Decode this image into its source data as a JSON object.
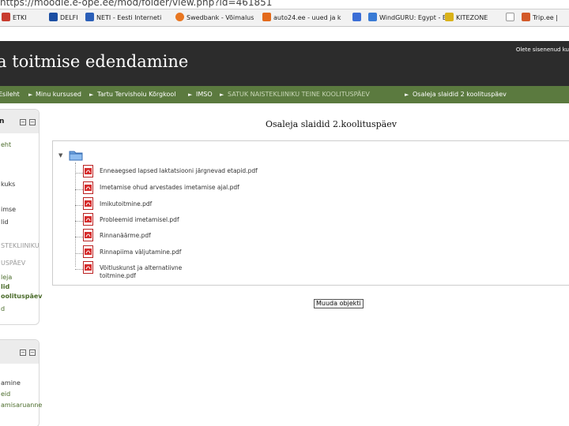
{
  "browser": {
    "url": "https://moodle.e-ope.ee/mod/folder/view.php?id=461851",
    "bookmarks": [
      {
        "label": "ETKI",
        "color": "#c83b2e"
      },
      {
        "label": "DELFI",
        "color": "#1c4fa3"
      },
      {
        "label": "NETI - Eesti Interneti",
        "color": "#2b5fb8"
      },
      {
        "label": "Swedbank - Võimalus",
        "color": "#e87722"
      },
      {
        "label": "auto24.ee - uued ja k",
        "color": "#e36a1b"
      },
      {
        "label": "",
        "color": "#3b6ed6"
      },
      {
        "label": "WindGURU: Egypt - E",
        "color": "#3a7bd5"
      },
      {
        "label": "KITEZONE",
        "color": "#d9b21a"
      },
      {
        "label": "",
        "color": "#ffffff"
      },
      {
        "label": "Trip.ee |",
        "color": "#d35a2a"
      }
    ]
  },
  "header": {
    "site_title": "a toitmise edendamine",
    "login_info": "Olete sisenenud ku"
  },
  "breadcrumb": {
    "items": [
      {
        "label": "Esileht"
      },
      {
        "label": "Minu kursused"
      },
      {
        "label": "Tartu Tervishoiu Kõrgkool"
      },
      {
        "label": "IMSO"
      },
      {
        "label": "SATUK NAISTEKLIINIKU TEINE KOOLITUSPÄEV"
      },
      {
        "label": "Osaleja slaidid 2 koolituspäev"
      }
    ]
  },
  "left_block_1": {
    "title": "n",
    "items": [
      "eht",
      "kuks",
      "imse",
      "lid",
      "",
      "STEKLIINIKU",
      "USPÄEV",
      "leja",
      "lid",
      "oolituspäev",
      "d"
    ]
  },
  "left_block_2": {
    "title": "",
    "items": [
      "amine",
      "eid",
      "amisaruanne"
    ]
  },
  "main": {
    "heading": "Osaleja slaidid 2.koolituspäev",
    "files": [
      {
        "name": "Enneaegsed lapsed laktatsiooni järgnevad etapid.pdf"
      },
      {
        "name": "Imetamise ohud arvestades imetamise ajal.pdf"
      },
      {
        "name": "Imikutoitmine.pdf"
      },
      {
        "name": "Probleemid imetamisel.pdf"
      },
      {
        "name": "Rinnanäärme.pdf"
      },
      {
        "name": "Rinnapiima väljutamine.pdf"
      },
      {
        "name": "Võitluskunst ja alternatiivne",
        "name_line2": "toitmine.pdf"
      }
    ],
    "edit_button": "Muuda objekti"
  },
  "colors": {
    "header_bg": "#2c2c2c",
    "breadcrumb_bg": "#5b7a3f",
    "link_green": "#4a6b2a"
  }
}
